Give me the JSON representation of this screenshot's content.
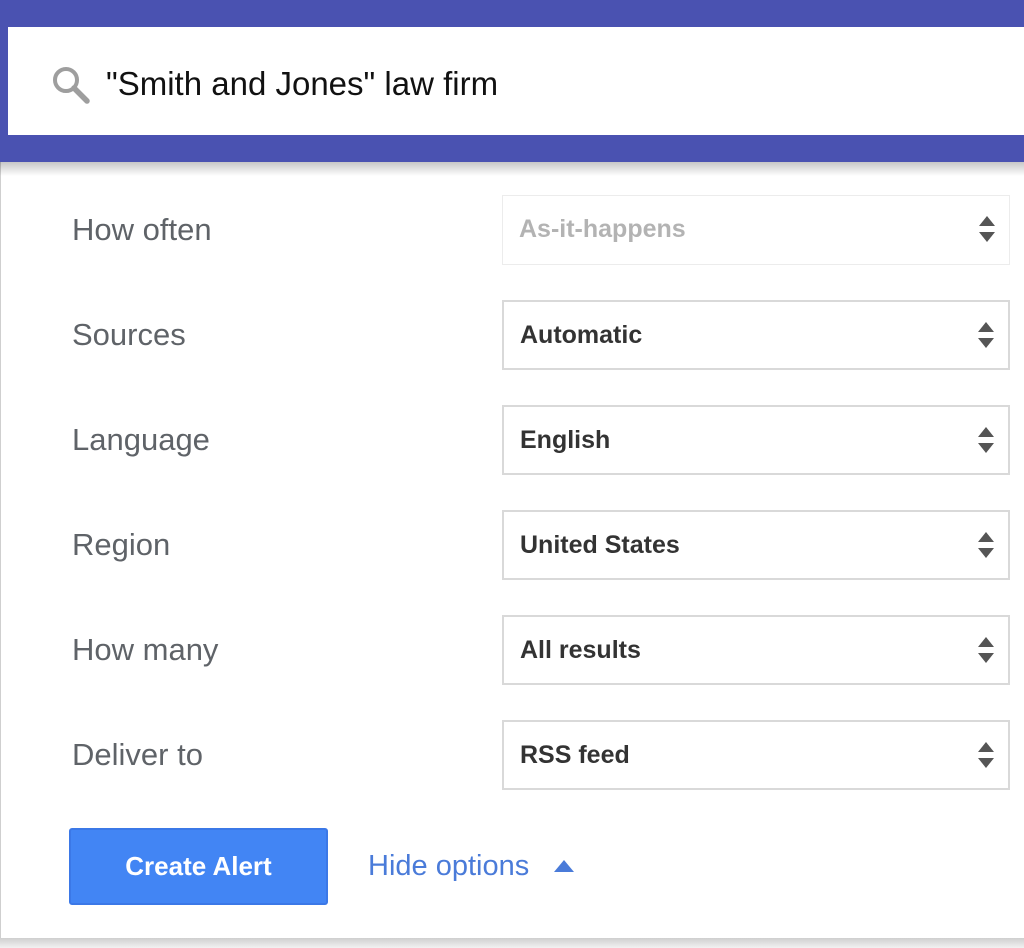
{
  "search": {
    "query": "\"Smith and Jones\" law firm",
    "icon": "search-icon"
  },
  "options": [
    {
      "label": "How often",
      "value": "As-it-happens",
      "disabled": true
    },
    {
      "label": "Sources",
      "value": "Automatic",
      "disabled": false
    },
    {
      "label": "Language",
      "value": "English",
      "disabled": false
    },
    {
      "label": "Region",
      "value": "United States",
      "disabled": false
    },
    {
      "label": "How many",
      "value": "All results",
      "disabled": false
    },
    {
      "label": "Deliver to",
      "value": "RSS feed",
      "disabled": false
    }
  ],
  "actions": {
    "create_label": "Create Alert",
    "hide_options_label": "Hide options"
  },
  "colors": {
    "header": "#4a52b1",
    "primary_button": "#4285f4",
    "link": "#4a7bd9"
  }
}
